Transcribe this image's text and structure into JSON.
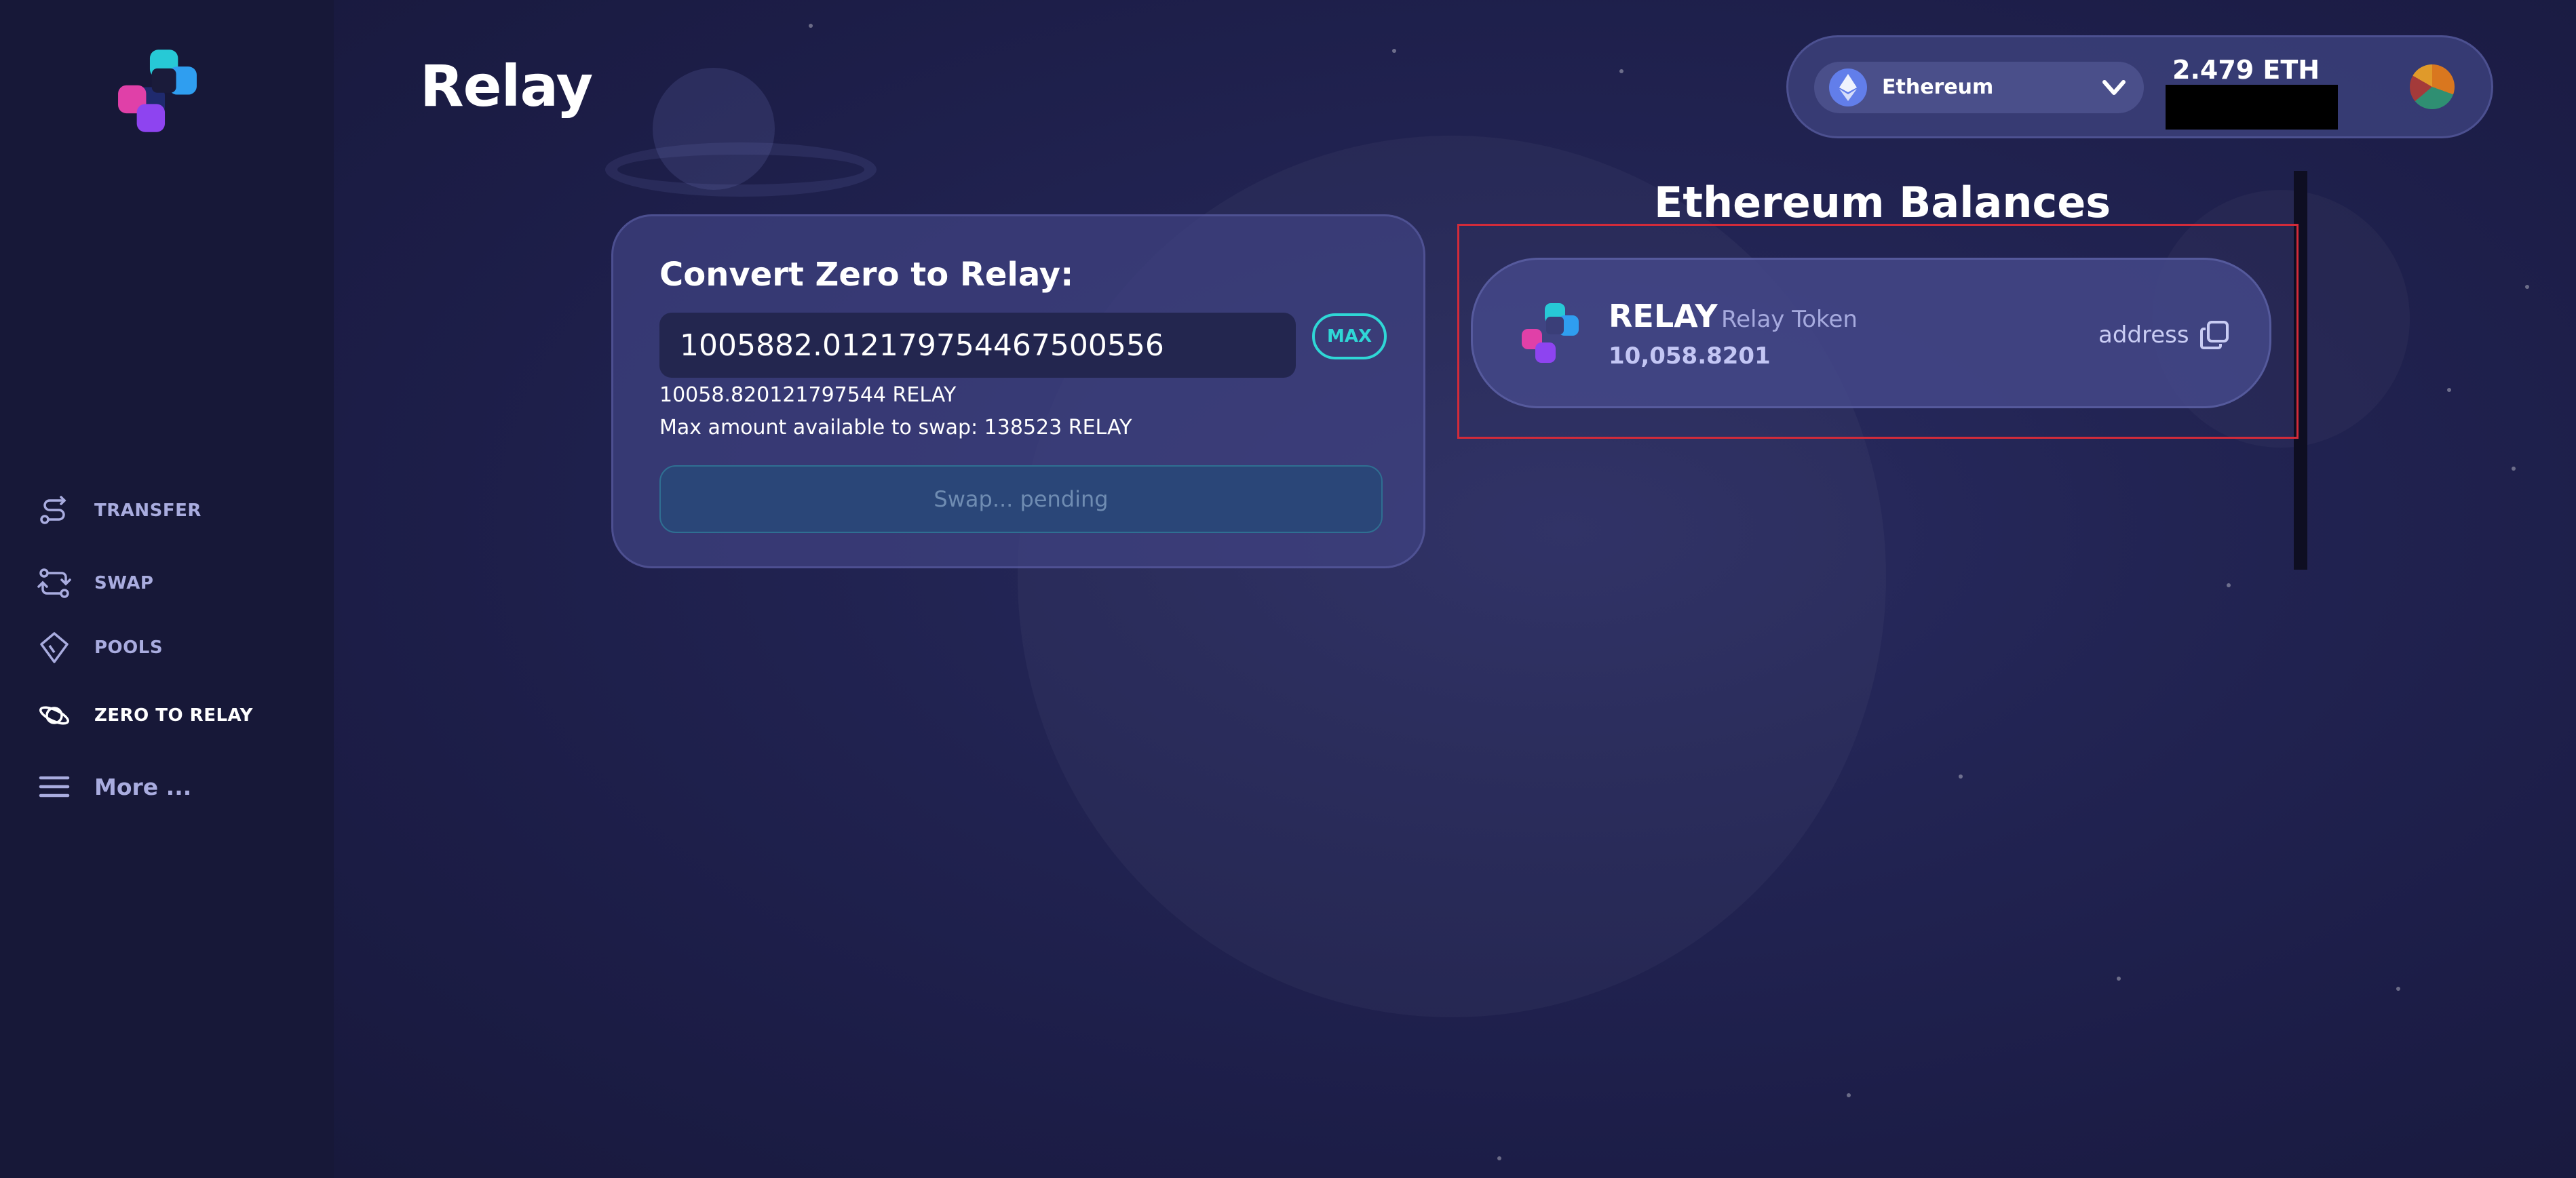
{
  "app": {
    "title": "Relay"
  },
  "sidebar": {
    "items": [
      {
        "label": "TRANSFER"
      },
      {
        "label": "SWAP"
      },
      {
        "label": "POOLS"
      },
      {
        "label": "ZERO TO RELAY"
      },
      {
        "label": "More ..."
      }
    ]
  },
  "header": {
    "network": "Ethereum",
    "eth_balance": "2.479 ETH"
  },
  "convert": {
    "title": "Convert Zero to Relay:",
    "amount_value": "1005882.012179754467500556",
    "max_label": "MAX",
    "converted_amount": "10058.820121797544 RELAY",
    "max_available": "Max amount available to swap: 138523 RELAY",
    "swap_button": "Swap... pending"
  },
  "balances": {
    "title": "Ethereum Balances",
    "tokens": [
      {
        "symbol": "RELAY",
        "name": "Relay Token",
        "amount": "10,058.8201",
        "address_label": "address"
      }
    ]
  },
  "colors": {
    "accent": "#2fd7d6",
    "highlight": "#d22b3a",
    "sidebar_bg": "#171838",
    "main_bg": "#222453"
  },
  "icons": [
    "relay-logo-icon",
    "transfer-icon",
    "swap-icon",
    "pools-icon",
    "planet-icon",
    "menu-icon",
    "ethereum-icon",
    "chevron-down-icon",
    "copy-icon",
    "avatar"
  ]
}
